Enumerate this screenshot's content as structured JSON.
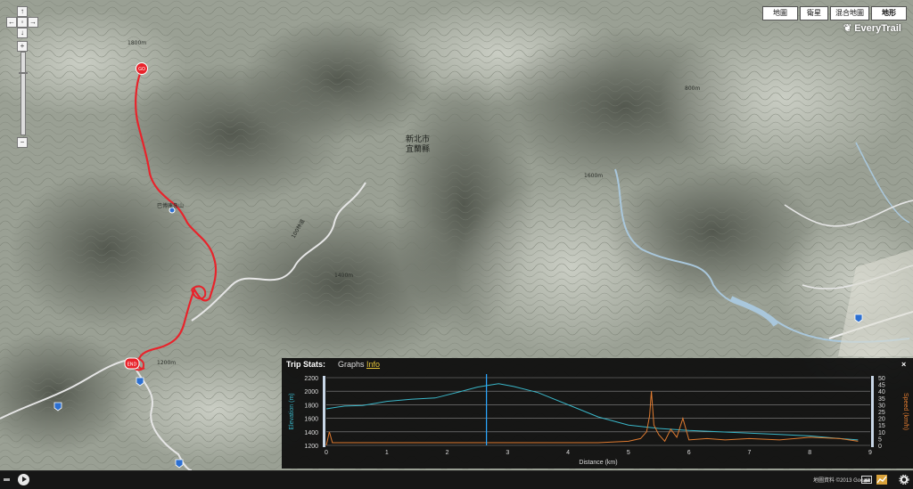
{
  "map": {
    "type_buttons": [
      "地圖",
      "衛星",
      "混合地圖",
      "地形"
    ],
    "brand": "EveryTrail",
    "labels": {
      "city": "新北市",
      "county": "宜蘭縣",
      "peak": "巴博庫魯山",
      "road": "100林道",
      "elev_1400": "1400m",
      "elev_1800": "1800m",
      "elev_1600": "1600m",
      "elev_1200": "1200m",
      "elev_800": "800m"
    },
    "route_color": "#e8232b",
    "markers": {
      "start": "GO",
      "end": "END"
    },
    "copyright": "地圖資料 ©2013 Google"
  },
  "trip_stats": {
    "title": "Trip Stats:",
    "tab_graphs": "Graphs",
    "tab_info": "Info",
    "close": "×"
  },
  "chart_data": {
    "type": "line",
    "xlabel": "Distance (km)",
    "x_ticks": [
      0,
      1,
      2,
      3,
      4,
      5,
      6,
      7,
      8,
      9
    ],
    "xlim": [
      0,
      9
    ],
    "y_left_label": "Elevation (m)",
    "y_left_ticks": [
      1200,
      1400,
      1600,
      1800,
      2000,
      2200
    ],
    "y_left_lim": [
      1200,
      2200
    ],
    "y_right_label": "Speed (km/h)",
    "y_right_ticks": [
      0,
      5,
      10,
      15,
      20,
      25,
      30,
      35,
      40,
      45,
      50
    ],
    "y_right_lim": [
      0,
      50
    ],
    "grid": true,
    "cursor_x": 2.65,
    "series": [
      {
        "axis": "left",
        "color": "#3ab6c8",
        "x": [
          0,
          0.3,
          0.6,
          1.0,
          1.4,
          1.8,
          2.2,
          2.5,
          2.7,
          2.85,
          3.1,
          3.5,
          4.0,
          4.5,
          5.0,
          5.5,
          6.0,
          6.5,
          7.0,
          7.5,
          8.0,
          8.5,
          8.8
        ],
        "values": [
          1740,
          1780,
          1790,
          1850,
          1880,
          1900,
          1990,
          2060,
          2090,
          2110,
          2070,
          1980,
          1800,
          1620,
          1500,
          1450,
          1420,
          1400,
          1380,
          1360,
          1340,
          1300,
          1280
        ]
      },
      {
        "axis": "right",
        "color": "#e07b30",
        "x": [
          0,
          0.05,
          0.1,
          0.5,
          1.0,
          1.5,
          2.0,
          2.5,
          3.0,
          3.5,
          4.0,
          4.5,
          5.0,
          5.2,
          5.3,
          5.35,
          5.38,
          5.42,
          5.5,
          5.6,
          5.7,
          5.8,
          5.9,
          6.0,
          6.3,
          6.6,
          7.0,
          7.5,
          8.0,
          8.5,
          8.8
        ],
        "values": [
          0,
          10,
          2,
          2,
          2,
          2,
          2,
          2,
          2,
          2,
          2,
          2,
          3,
          5,
          10,
          22,
          40,
          15,
          8,
          3,
          12,
          6,
          20,
          4,
          5,
          4,
          5,
          4,
          6,
          5,
          3
        ]
      }
    ]
  }
}
